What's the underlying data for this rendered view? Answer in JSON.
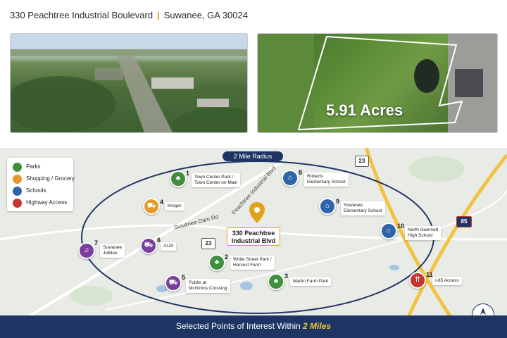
{
  "header": {
    "street": "330 Peachtree Industrial Boulevard",
    "separator": "|",
    "city": "Suwanee, GA 30024"
  },
  "hero": {
    "acres_label": "5.91 Acres"
  },
  "legend": [
    {
      "label": "Parks",
      "icon": "tree-icon",
      "color": "#3f8f3c"
    },
    {
      "label": "Shopping / Grocery",
      "icon": "cart-icon",
      "color": "#e39a2c"
    },
    {
      "label": "Schools",
      "icon": "school-icon",
      "color": "#2f64a8"
    },
    {
      "label": "Highway Access",
      "icon": "highway-icon",
      "color": "#c4362f"
    }
  ],
  "map": {
    "radius_label": "2 Mile Radius",
    "subject": {
      "line1": "330 Peachtree",
      "line2": "Industrial Blvd"
    },
    "roads": {
      "suwanee_dam": "Suwanee Dam Rd",
      "peachtree": "Peachtree Industrial Blvd"
    },
    "shields": {
      "route_23_top": "23",
      "route_23_mid": "23",
      "i85": "85"
    },
    "pois": [
      {
        "num": "1",
        "line1": "Town Center Park /",
        "line2": "Town Center on Main",
        "category": "park"
      },
      {
        "num": "2",
        "line1": "White Street Park /",
        "line2": "Harvest Farm",
        "category": "park"
      },
      {
        "num": "3",
        "line1": "Martin Farm Park",
        "line2": "",
        "category": "park"
      },
      {
        "num": "4",
        "line1": "Kroger",
        "line2": "",
        "category": "shopping"
      },
      {
        "num": "5",
        "line1": "Publix at",
        "line2": "McGinnis Crossing",
        "category": "shopping"
      },
      {
        "num": "6",
        "line1": "ALDI",
        "line2": "",
        "category": "shopping"
      },
      {
        "num": "7",
        "line1": "Suwanee",
        "line2": "Jubilee",
        "category": "shopping"
      },
      {
        "num": "8",
        "line1": "Roberts",
        "line2": "Elementary School",
        "category": "school"
      },
      {
        "num": "9",
        "line1": "Suwanee",
        "line2": "Elementary School",
        "category": "school"
      },
      {
        "num": "10",
        "line1": "North Gwinnett",
        "line2": "High School",
        "category": "school"
      },
      {
        "num": "11",
        "line1": "I-85 Access",
        "line2": "",
        "category": "highway"
      }
    ]
  },
  "footer": {
    "text": "Selected Points of Interest Within",
    "highlight": "2 Miles"
  },
  "compass": {
    "label": "N"
  },
  "colors": {
    "navy": "#1e3563",
    "gold": "#e0a21a",
    "park": "#3f8f3c",
    "shopping": "#e39a2c",
    "school": "#2f64a8",
    "highway": "#c4362f",
    "poi7": "#7a3fa0"
  }
}
